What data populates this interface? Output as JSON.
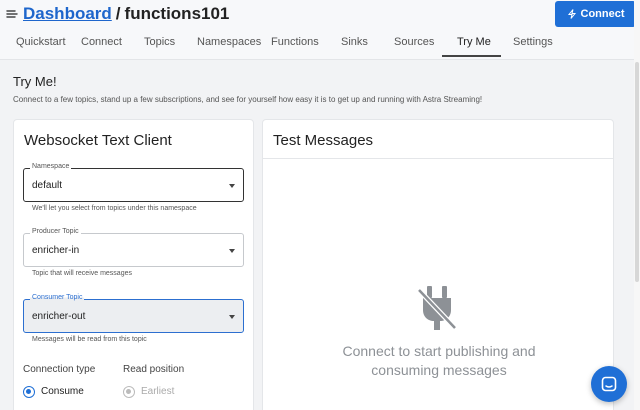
{
  "header": {
    "breadcrumb_root": "Dashboard",
    "breadcrumb_separator": "/",
    "breadcrumb_current": "functions101",
    "connect_label": "Connect",
    "icons": [
      "hamburger-icon",
      "lightning-icon"
    ]
  },
  "tabs": [
    {
      "label": "Quickstart",
      "active": false
    },
    {
      "label": "Connect",
      "active": false
    },
    {
      "label": "Topics",
      "active": false
    },
    {
      "label": "Namespaces",
      "active": false
    },
    {
      "label": "Functions",
      "active": false
    },
    {
      "label": "Sinks",
      "active": false
    },
    {
      "label": "Sources",
      "active": false
    },
    {
      "label": "Try Me",
      "active": true
    },
    {
      "label": "Settings",
      "active": false
    }
  ],
  "page": {
    "title": "Try Me!",
    "description": "Connect to a few topics, stand up a few subscriptions, and see for yourself how easy it is to get up and running with Astra Streaming!"
  },
  "client": {
    "title": "Websocket Text Client",
    "namespace": {
      "label": "Namespace",
      "value": "default",
      "helper": "We'll let you select from topics under this namespace"
    },
    "producer": {
      "label": "Producer Topic",
      "value": "enricher-in",
      "helper": "Topic that will receive messages"
    },
    "consumer": {
      "label": "Consumer Topic",
      "value": "enricher-out",
      "helper": "Messages will be read from this topic"
    },
    "connection_type_label": "Connection type",
    "connection_type_value": "Consume",
    "read_position_label": "Read position",
    "read_position_value": "Earliest"
  },
  "messages": {
    "title": "Test Messages",
    "empty_line1": "Connect to start publishing and",
    "empty_line2": "consuming messages",
    "empty_icon": "plug-off-icon"
  },
  "colors": {
    "accent": "#1f6fd6",
    "link": "#1e66cc"
  },
  "chat_icon": "chat-icon"
}
